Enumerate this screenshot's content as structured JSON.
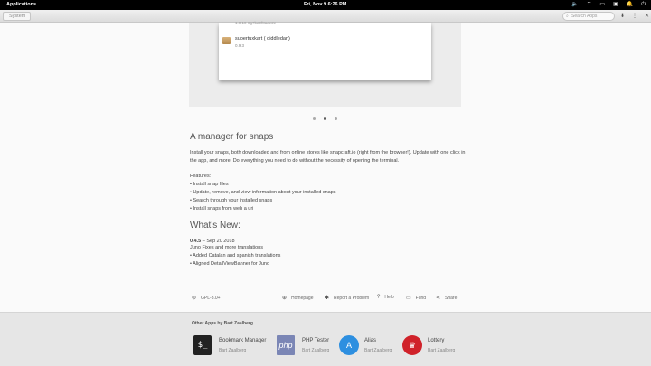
{
  "panel": {
    "applications": "Applications",
    "clock": "Fri, Nov 9    6:26 PM",
    "tray_icons": [
      "volume-icon",
      "wifi-icon",
      "battery-icon",
      "display-icon",
      "notification-icon",
      "power-icon"
    ]
  },
  "headerbar": {
    "back_label": "System",
    "search_placeholder": "Search Apps"
  },
  "screenshot": {
    "prev_subtitle": "1.0.10-8g7ba9f8ade2e",
    "item_name": "supertuxkart ( diddledan)",
    "item_version": "0.9.3"
  },
  "carousel": {
    "count": 3,
    "active": 1
  },
  "description": {
    "heading": "A manager for snaps",
    "para": "Install your snaps, both downloaded and from online stores like snapcraft.io (right from the browser!). Update with one click in the app, and more! Do everything you need to do without the necessity of opening the terminal.",
    "features_label": "Features:",
    "features": [
      "• Install snap files",
      "• Update, remove, and view information about your installed snaps",
      "• Search through your installed snaps",
      "• Install snaps from web a uri"
    ]
  },
  "whats_new": {
    "heading": "What's New:",
    "version": "0.4.5",
    "date": " – Sep 20 2018",
    "summary": "Juno Fixes and more translations",
    "items": [
      "• Added Catalan and spanish translations",
      "• Aligned DetailViewBanner for Juno"
    ]
  },
  "footer_links": {
    "license": "GPL-3.0+",
    "homepage": "Homepage",
    "report": "Report a Problem",
    "help": "Help",
    "fund": "Fund",
    "share": "Share"
  },
  "other_apps": {
    "title": "Other Apps by Bart Zaalberg",
    "apps": [
      {
        "name": "Bookmark Manager",
        "author": "Bart Zaalberg",
        "glyph": "$_"
      },
      {
        "name": "PHP Tester",
        "author": "Bart Zaalberg",
        "glyph": "php"
      },
      {
        "name": "Alias",
        "author": "Bart Zaalberg",
        "glyph": "A"
      },
      {
        "name": "Lottery",
        "author": "Bart Zaalberg",
        "glyph": "♛"
      }
    ]
  }
}
